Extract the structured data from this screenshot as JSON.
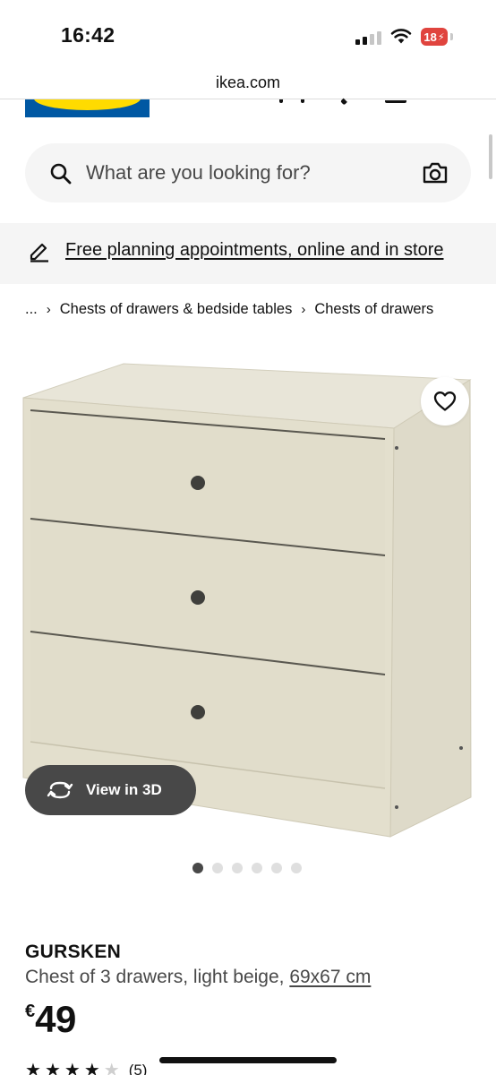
{
  "status_bar": {
    "time": "16:42",
    "battery": "18"
  },
  "browser": {
    "url": "ikea.com"
  },
  "search": {
    "placeholder": "What are you looking for?"
  },
  "banner": {
    "text": "Free planning appointments, online and in store"
  },
  "breadcrumb": {
    "ellipsis": "...",
    "items": [
      "Chests of drawers & bedside tables",
      "Chests of drawers"
    ]
  },
  "gallery": {
    "view_3d_label": "View in 3D",
    "image_count": 6,
    "active_index": 0
  },
  "product": {
    "name": "GURSKEN",
    "description": "Chest of 3 drawers, light beige, ",
    "size": "69x67 cm",
    "currency": "€",
    "price": "49",
    "rating": 4,
    "rating_max": 5,
    "review_count": "(5)"
  },
  "colors": {
    "ikea_blue": "#0058a3",
    "ikea_yellow": "#ffdb00",
    "surface_grey": "#f5f5f5",
    "battery_red": "#e0443e",
    "chest_beige": "#e3dfcd"
  },
  "icons": [
    "search-icon",
    "camera-icon",
    "pencil-icon",
    "heart-icon",
    "rotate-3d-icon",
    "star-icon",
    "wifi-icon",
    "signal-icon"
  ]
}
